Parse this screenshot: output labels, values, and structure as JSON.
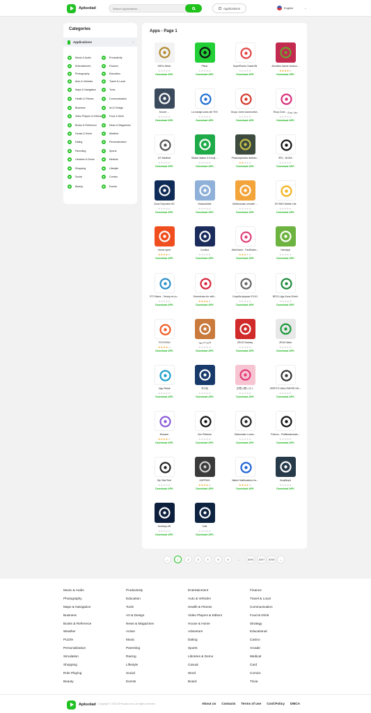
{
  "header": {
    "logo": "Apksolad",
    "search_placeholder": "Search Applications ...",
    "apps_button": "Applications",
    "language": "English"
  },
  "categories": {
    "title": "Categories",
    "active": "Applications",
    "items": [
      "Music & Audio",
      "Productivity",
      "Entertainment",
      "Finance",
      "Photography",
      "Education",
      "Auto & Vehicles",
      "Travel & Local",
      "Maps & Navigation",
      "Tools",
      "Health & Fitness",
      "Communication",
      "Business",
      "Art & Design",
      "Video Players & Editors",
      "Food & Drink",
      "Books & Reference",
      "News & Magazines",
      "House & Home",
      "Weather",
      "Dating",
      "Personalization",
      "Parenting",
      "Sports",
      "Libraries & Demo",
      "Medical",
      "Shopping",
      "Lifestyle",
      "Social",
      "Comics",
      "Beauty",
      "Events"
    ]
  },
  "main": {
    "title": "Apps - Page 1",
    "download_label": "Download APK"
  },
  "apps": [
    {
      "name": "WiFro Mesh",
      "rating": 0,
      "icon_name": "wifi-router-icon",
      "bg": "#f3f3f3",
      "fg": "#b08a2e"
    },
    {
      "name": "Pilear",
      "rating": 0,
      "icon_name": "corner-frame-icon",
      "bg": "#22cf36",
      "fg": "#111111"
    },
    {
      "name": "SuperPacks ClassHIN",
      "rating": 0,
      "icon_name": "cartoon-face-icon",
      "bg": "#ffffff",
      "fg": "#e24444"
    },
    {
      "name": "Aerobics dance workou...",
      "rating": 4,
      "icon_name": "dancer-icon",
      "bg": "#c22a4f",
      "fg": "#6aa331"
    },
    {
      "name": "Soccer ...",
      "rating": 0,
      "icon_name": "soccer-g-icon",
      "bg": "#3a4a5c",
      "fg": "#ffffff"
    },
    {
      "name": "La navaja suiza del TES",
      "rating": 0,
      "icon_name": "medical-star-icon",
      "bg": "#ffffff",
      "fg": "#1f6fd1"
    },
    {
      "name": "Grupo Jorne Automotive...",
      "rating": 0,
      "icon_name": "jorne-logo-icon",
      "bg": "#ffffff",
      "fg": "#d33a2c"
    },
    {
      "name": "Rosy Zone - زون روزی",
      "rating": 0,
      "icon_name": "rosy-zone-icon",
      "bg": "#ffffff",
      "fg": "#d6317a"
    },
    {
      "name": "NT BizMeet",
      "rating": 0,
      "icon_name": "bizmeet-text-icon",
      "bg": "#ffffff",
      "fg": "#555555"
    },
    {
      "name": "Sticker Maker & Emoji ...",
      "rating": 0,
      "icon_name": "emoji-plus-icon",
      "bg": "#1faa4a",
      "fg": "#ffffff"
    },
    {
      "name": "Phasmophobia detecto...",
      "rating": 2,
      "icon_name": "detector-icon",
      "bg": "#3d4a3e",
      "fg": "#c9c24a"
    },
    {
      "name": "보다 - BODA",
      "rating": 0,
      "icon_name": "boda-text-icon",
      "bg": "#ffffff",
      "fg": "#111111"
    },
    {
      "name": "Zona Deportes HD",
      "rating": 0,
      "icon_name": "zoho-logo-icon",
      "bg": "#0f2b57",
      "fg": "#ffffff"
    },
    {
      "name": "Seasonbible",
      "rating": 0,
      "icon_name": "bible-plus-icon",
      "bg": "#8fb0d8",
      "fg": "#ffffff"
    },
    {
      "name": "Мобильные онлайн ...",
      "rating": 0,
      "icon_name": "mobile-shop-icon",
      "bg": "#f3a43a",
      "fg": "#ffffff"
    },
    {
      "name": "ZH SMS Mobile Lite",
      "rating": 0,
      "icon_name": "z-letter-icon",
      "bg": "#ffffff",
      "fg": "#f2b21b"
    },
    {
      "name": "ebone sport",
      "rating": 4,
      "icon_name": "s-arrow-icon",
      "bg": "#f04e1f",
      "fg": "#ffffff"
    },
    {
      "name": "Cordica",
      "rating": 0,
      "icon_name": "cordica-clover-icon",
      "bg": "#1a2b5c",
      "fg": "#ffffff"
    },
    {
      "name": "AllaVoices - FacEbabo...",
      "rating": 3,
      "icon_name": "bubbles-icon",
      "bg": "#ffffff",
      "fg": "#e0417a"
    },
    {
      "name": "HarsApp",
      "rating": 0,
      "icon_name": "fleur-icon",
      "bg": "#6db33f",
      "fg": "#ffffff"
    },
    {
      "name": "ST2 Mana - Этому не уч...",
      "rating": 0,
      "icon_name": "puzzle-icon",
      "bg": "#ffffff",
      "fg": "#2b8fc9"
    },
    {
      "name": "Gemstones for with...",
      "rating": 4,
      "icon_name": "gem-heart-icon",
      "bg": "#ffffff",
      "fg": "#d8243a"
    },
    {
      "name": "Служба формы ЕЭ-91",
      "rating": 0,
      "icon_name": "clock-form-icon",
      "bg": "#ffffff",
      "fg": "#666666"
    },
    {
      "name": "BESJ-Liga Zona Zürich",
      "rating": 0,
      "icon_name": "tree-ring-icon",
      "bg": "#ffffff",
      "fg": "#1e8a3a"
    },
    {
      "name": "TOYOSHU",
      "rating": 4,
      "icon_name": "zf-logo-icon",
      "bg": "#ffffff",
      "fg": "#f05a24"
    },
    {
      "name": "قارئ اندروید",
      "rating": 0,
      "icon_name": "pattern-icon",
      "bg": "#c97a3c",
      "fg": "#ffffff"
    },
    {
      "name": "ZEUS Norway",
      "rating": 0,
      "icon_name": "norway-flag-icon",
      "bg": "#d02a2a",
      "fg": "#ffffff"
    },
    {
      "name": "ZEUS Italia",
      "rating": 0,
      "icon_name": "italy-flag-icon",
      "bg": "#e8e8e8",
      "fg": "#1a9a3a"
    },
    {
      "name": "Vigo Retail",
      "rating": 0,
      "icon_name": "vigo-logo-icon",
      "bg": "#ffffff",
      "fg": "#1aa0c8"
    },
    {
      "name": "차이점",
      "rating": 0,
      "icon_name": "car-icon",
      "bg": "#183a6b",
      "fg": "#ffffff"
    },
    {
      "name": "お買い物リスト",
      "rating": 0,
      "icon_name": "cart-icon",
      "bg": "#f7c4d2",
      "fg": "#e23a7a"
    },
    {
      "name": "ZEPETO WALLPAPER HD...",
      "rating": 0,
      "icon_name": "phones-icon",
      "bg": "#ffffff",
      "fg": "#333333"
    },
    {
      "name": "Browser",
      "rating": 4,
      "icon_name": "play-circle-icon",
      "bg": "#ffffff",
      "fg": "#8a5ad8"
    },
    {
      "name": "Zen Pettento",
      "rating": 0,
      "icon_name": "zen-text-icon",
      "bg": "#ffffff",
      "fg": "#111111"
    },
    {
      "name": "Silverwater Lumin...",
      "rating": 0,
      "icon_name": "lens-icon",
      "bg": "#ffffff",
      "fg": "#222222"
    },
    {
      "name": "Pollcon - Politikssimulato...",
      "rating": 0,
      "icon_name": "sound-waves-icon",
      "bg": "#ffffff",
      "fg": "#111111"
    },
    {
      "name": "My Vital Test",
      "rating": 0,
      "icon_name": "atom-icon",
      "bg": "#ffffff",
      "fg": "#222222"
    },
    {
      "name": "ZAPPING",
      "rating": 4,
      "icon_name": "z-coin-icon",
      "bg": "#3a3a3a",
      "fg": "#d0d0d0"
    },
    {
      "name": "Watch Notifications for...",
      "rating": 4,
      "icon_name": "bell-icon",
      "bg": "#ffffff",
      "fg": "#1e63d4"
    },
    {
      "name": "KrayBeyld",
      "rating": 0,
      "icon_name": "star-shield-icon",
      "bg": "#273a4a",
      "fg": "#ffffff"
    },
    {
      "name": "SeeMap AR",
      "rating": 0,
      "icon_name": "seemap-icon",
      "bg": "#0d1f3c",
      "fg": "#ffffff"
    },
    {
      "name": "Zuitt",
      "rating": 0,
      "icon_name": "zuitt-icon",
      "bg": "#0d2340",
      "fg": "#ffffff"
    }
  ],
  "pagination": {
    "prev": "←",
    "pages": [
      "1",
      "2",
      "3",
      "4",
      "5",
      "6",
      "...",
      "8250",
      "8257",
      "8258"
    ],
    "next": "→",
    "active": "1"
  },
  "footer": {
    "col1": [
      "Music & Audio",
      "Photography",
      "Maps & Navigation",
      "Business",
      "Books & Reference",
      "Weather",
      "Puzzle",
      "Personalization",
      "Simulation",
      "Shopping",
      "Role Playing",
      "Beauty"
    ],
    "col2": [
      "Productivity",
      "Education",
      "Tools",
      "Art & Design",
      "News & Magazines",
      "Action",
      "Music",
      "Parenting",
      "Racing",
      "Lifestyle",
      "Social",
      "Events"
    ],
    "col3": [
      "Entertainment",
      "Auto & Vehicles",
      "Health & Fitness",
      "Video Players & Editors",
      "House & Home",
      "Adventure",
      "Dating",
      "Sports",
      "Libraries & Demo",
      "Casual",
      "Word",
      "Board"
    ],
    "col4": [
      "Finance",
      "Travel & Local",
      "Communication",
      "Food & Drink",
      "Strategy",
      "Educational",
      "Casino",
      "Arcade",
      "Medical",
      "Card",
      "Comics",
      "Trivia"
    ],
    "logo": "Apksolad",
    "copyright": "Copyright © 2022 APKsolad.com | All rights reserved.",
    "links": [
      "About us",
      "Contacts",
      "Terms of use",
      "Conf.Policy",
      "DMCA"
    ]
  },
  "colors": {
    "accent": "#22c124",
    "star": "#f2a627",
    "star_empty": "#cccccc"
  }
}
